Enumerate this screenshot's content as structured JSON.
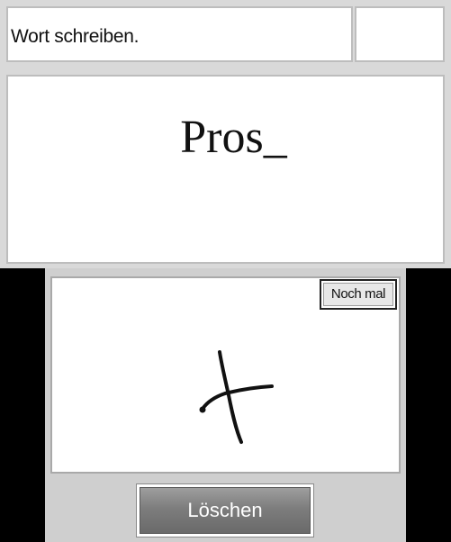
{
  "top": {
    "instruction": "Wort schreiben.",
    "word": "Pros_"
  },
  "bottom": {
    "retry_label": "Noch mal",
    "clear_label": "Löschen"
  }
}
